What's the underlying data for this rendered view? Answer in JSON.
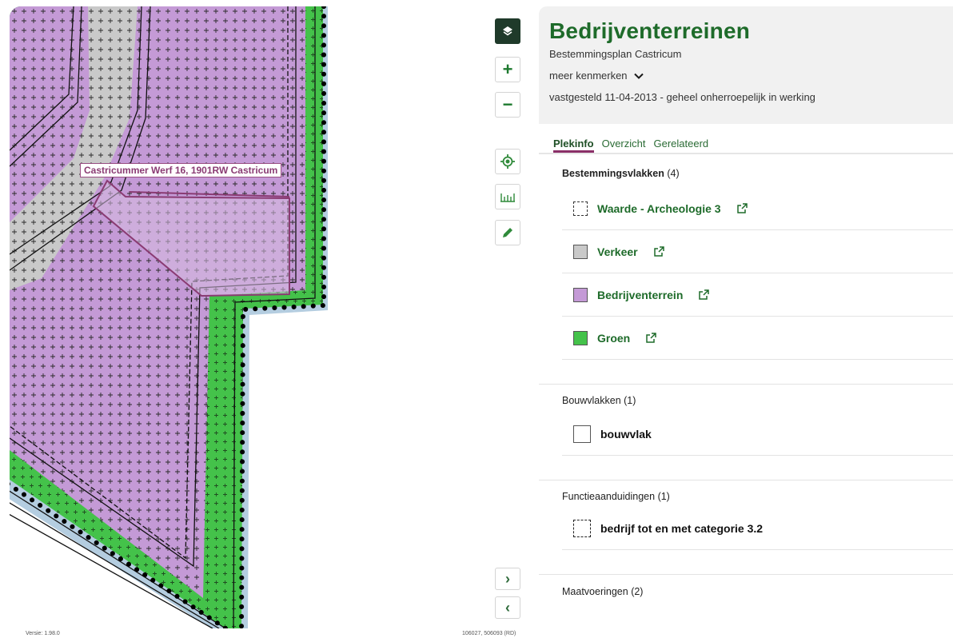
{
  "map": {
    "address_label": "Castricummer Werf 16, 1901RW Castricum",
    "version": "Versie: 1.98.0",
    "coordinates": "106027, 506093 (RD)",
    "controls": [
      "layers-icon",
      "zoom-in-icon",
      "zoom-out-icon",
      "locate-icon",
      "measure-icon",
      "draw-icon",
      "expand-panel-icon",
      "collapse-panel-icon"
    ],
    "colors": {
      "bedrijventerrein": "#c49ad6",
      "verkeer": "#c9c9c9",
      "groen": "#44c24a",
      "water": "#b4cde0",
      "selection": "#8a3b73"
    }
  },
  "panel": {
    "title": "Bedrijventerreinen",
    "subtitle": "Bestemmingsplan  Castricum",
    "meer_label": "meer kenmerken",
    "status": "vastgesteld 11-04-2013 - geheel onherroepelijk in werking",
    "tabs": [
      {
        "label": "Plekinfo",
        "active": true
      },
      {
        "label": "Overzicht",
        "active": false
      },
      {
        "label": "Gerelateerd",
        "active": false
      }
    ],
    "sections": {
      "bestemmingsvlakken": {
        "title": "Bestemmingsvlakken",
        "count": "(4)",
        "items": [
          {
            "label": "Waarde - Archeologie 3",
            "swatch": "dashed"
          },
          {
            "label": "Verkeer",
            "swatch": "#c9c9c9"
          },
          {
            "label": "Bedrijventerrein",
            "swatch": "#c49ad6"
          },
          {
            "label": "Groen",
            "swatch": "#44c24a"
          }
        ]
      },
      "bouwvlakken": {
        "title": "Bouwvlakken",
        "count": "(1)",
        "items": [
          {
            "label": "bouwvlak",
            "swatch": "plain"
          }
        ]
      },
      "functieaanduidingen": {
        "title": "Functieaanduidingen",
        "count": "(1)",
        "items": [
          {
            "label": "bedrijf tot en met categorie 3.2",
            "swatch": "dashed"
          }
        ]
      },
      "maatvoeringen": {
        "title": "Maatvoeringen",
        "count": "(2)"
      }
    }
  }
}
